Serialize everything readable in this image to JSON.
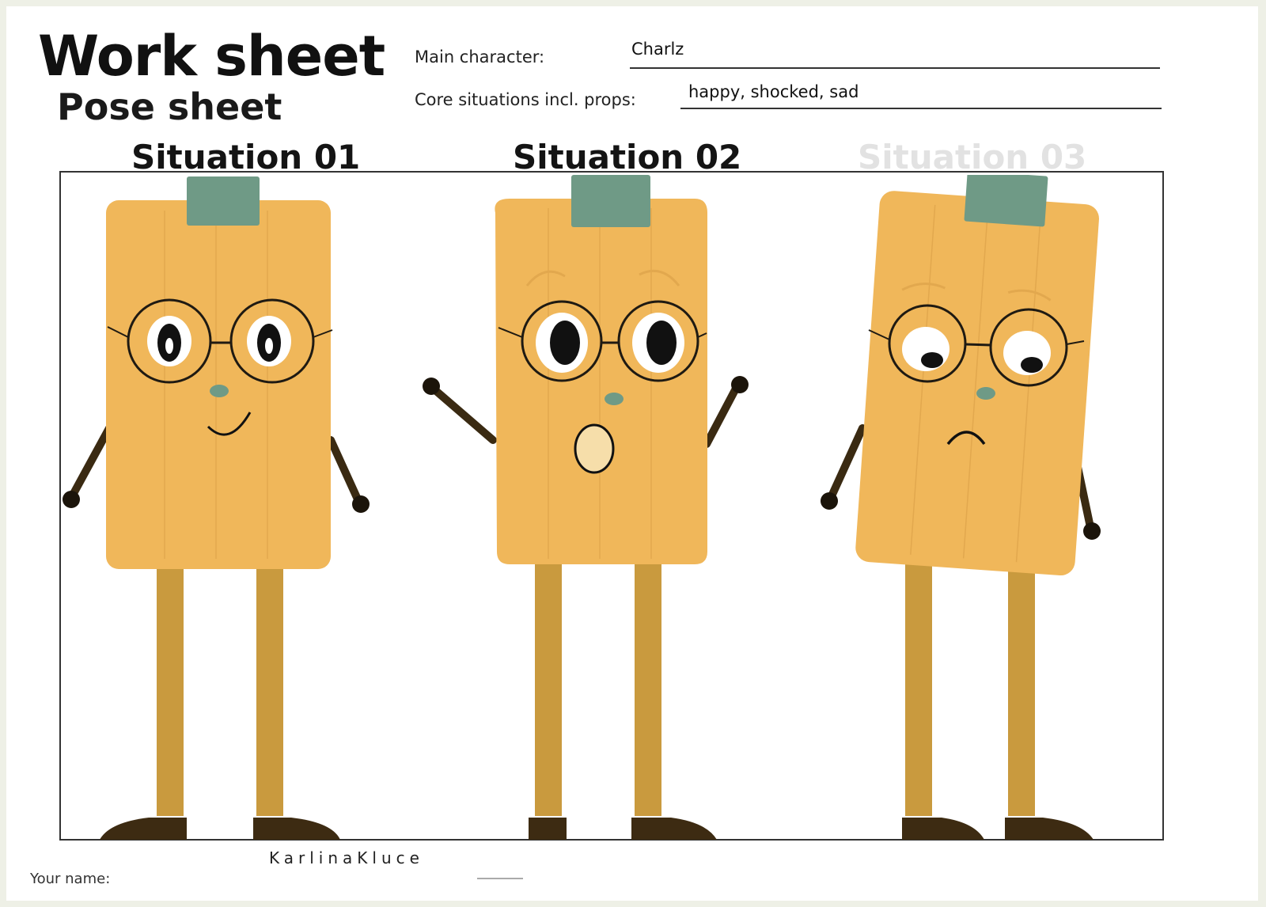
{
  "header": {
    "title": "Work sheet",
    "subtitle": "Pose sheet"
  },
  "fields": {
    "main_character_label": "Main character:",
    "main_character_value": "Charlz",
    "core_situations_label": "Core situations incl. props:",
    "core_situations_value": "happy, shocked, sad"
  },
  "situations": [
    {
      "title": "Situation 01",
      "expression": "happy"
    },
    {
      "title": "Situation 02",
      "expression": "shocked"
    },
    {
      "title": "Situation 03",
      "expression": "sad"
    }
  ],
  "footer": {
    "name_label": "Your name:",
    "name_value": "KarlinaKluce"
  },
  "colors": {
    "body": "#f0b75a",
    "hat": "#6f9a86",
    "legs": "#c99a3e",
    "arms": "#3a2a12",
    "shoes": "#3d2b12",
    "nose": "#6f9a86",
    "mouth_shocked": "#f6deaa"
  }
}
